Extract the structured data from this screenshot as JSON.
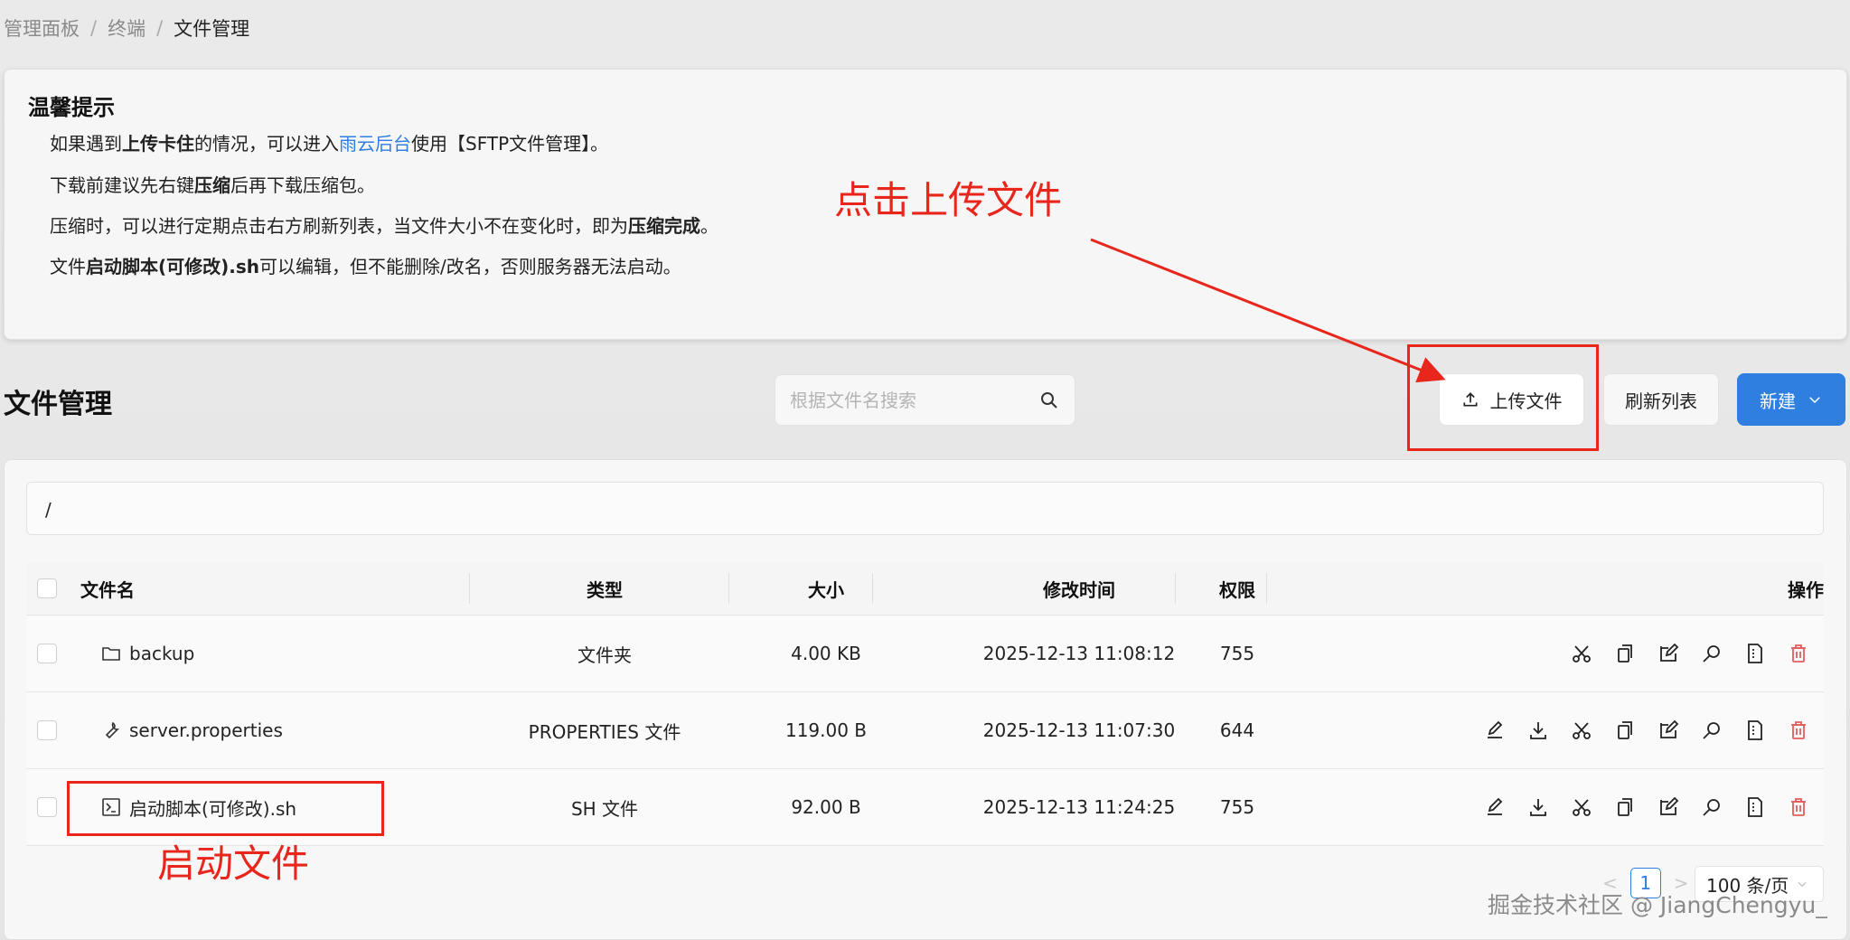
{
  "breadcrumb": [
    "管理面板",
    "终端",
    "文件管理"
  ],
  "tips": {
    "title": "温馨提示",
    "line1_pre": "如果遇到",
    "line1_b": "上传卡住",
    "line1_mid": "的情况，可以进入",
    "line1_link": "雨云后台",
    "line1_post": "使用【SFTP文件管理】。",
    "line2_pre": "下载前建议先右键",
    "line2_b": "压缩",
    "line2_post": "后再下载压缩包。",
    "line3_pre": "压缩时，可以进行定期点击右方刷新列表，当文件大小不在变化时，即为",
    "line3_b": "压缩完成",
    "line3_post": "。",
    "line4_pre": "文件",
    "line4_b": "启动脚本(可修改).sh",
    "line4_post": "可以编辑，但不能删除/改名，否则服务器无法启动。"
  },
  "annotations": {
    "upload": "点击上传文件",
    "start": "启动文件"
  },
  "section_title": "文件管理",
  "search": {
    "placeholder": "根据文件名搜索",
    "icon": "search-icon"
  },
  "buttons": {
    "upload": "上传文件",
    "refresh": "刷新列表",
    "new": "新建"
  },
  "path": "/",
  "table": {
    "headers": {
      "name": "文件名",
      "type": "类型",
      "size": "大小",
      "time": "修改时间",
      "perm": "权限",
      "ops": "操作"
    },
    "rows": [
      {
        "name": "backup",
        "icon": "folder-icon",
        "type": "文件夹",
        "size": "4.00 KB",
        "time": "2025-12-13 11:08:12",
        "perm": "755"
      },
      {
        "name": "server.properties",
        "icon": "wrench-icon",
        "type": "PROPERTIES 文件",
        "size": "119.00 B",
        "time": "2025-12-13 11:07:30",
        "perm": "644"
      },
      {
        "name": "启动脚本(可修改).sh",
        "icon": "terminal-icon",
        "type": "SH 文件",
        "size": "92.00 B",
        "time": "2025-12-13 11:24:25",
        "perm": "755"
      }
    ]
  },
  "pager": {
    "current": "1",
    "per_page": "100 条/页"
  },
  "watermark": "掘金技术社区 @ JiangChengyu_",
  "colors": {
    "accent": "#2f7fe0",
    "annotation": "#e8261c",
    "danger": "#e25c5c"
  }
}
